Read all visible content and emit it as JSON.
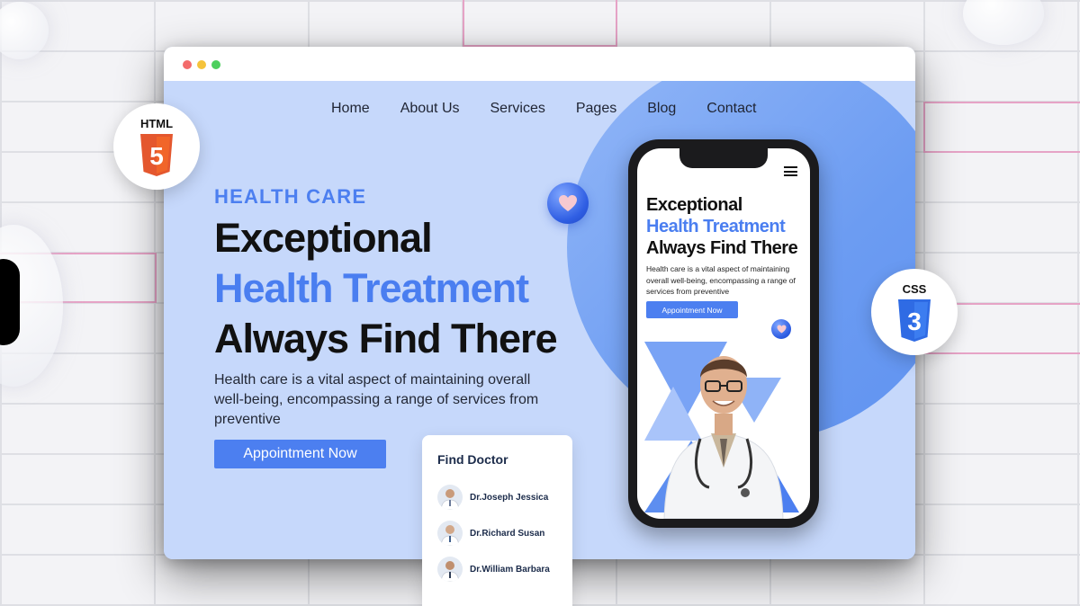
{
  "window": {
    "nav": [
      "Home",
      "About Us",
      "Services",
      "Pages",
      "Blog",
      "Contact"
    ],
    "hero": {
      "eyebrow": "HEALTH CARE",
      "line1": "Exceptional",
      "line2": "Health Treatment",
      "line3": "Always Find There",
      "description": "Health care is a vital aspect of maintaining overall well-being, encompassing a range of services from preventive",
      "cta_label": "Appointment Now"
    },
    "find_doctor": {
      "title": "Find Doctor",
      "doctors": [
        "Dr.Joseph Jessica",
        "Dr.Richard Susan",
        "Dr.William Barbara"
      ]
    }
  },
  "phone": {
    "line1": "Exceptional",
    "line2": "Health Treatment",
    "line3": "Always Find There",
    "description": "Health care is a vital aspect of maintaining overall well-being, encompassing a range of services from preventive",
    "cta_label": "Appointment Now"
  },
  "badges": {
    "html": "HTML",
    "html_digit": "5",
    "css": "CSS",
    "css_digit": "3"
  },
  "colors": {
    "accent": "#4c7ff0",
    "hero_bg": "#c6d8fb",
    "circle": "#6c9cf2",
    "html5": "#e4572e",
    "css3": "#2f6be4"
  }
}
